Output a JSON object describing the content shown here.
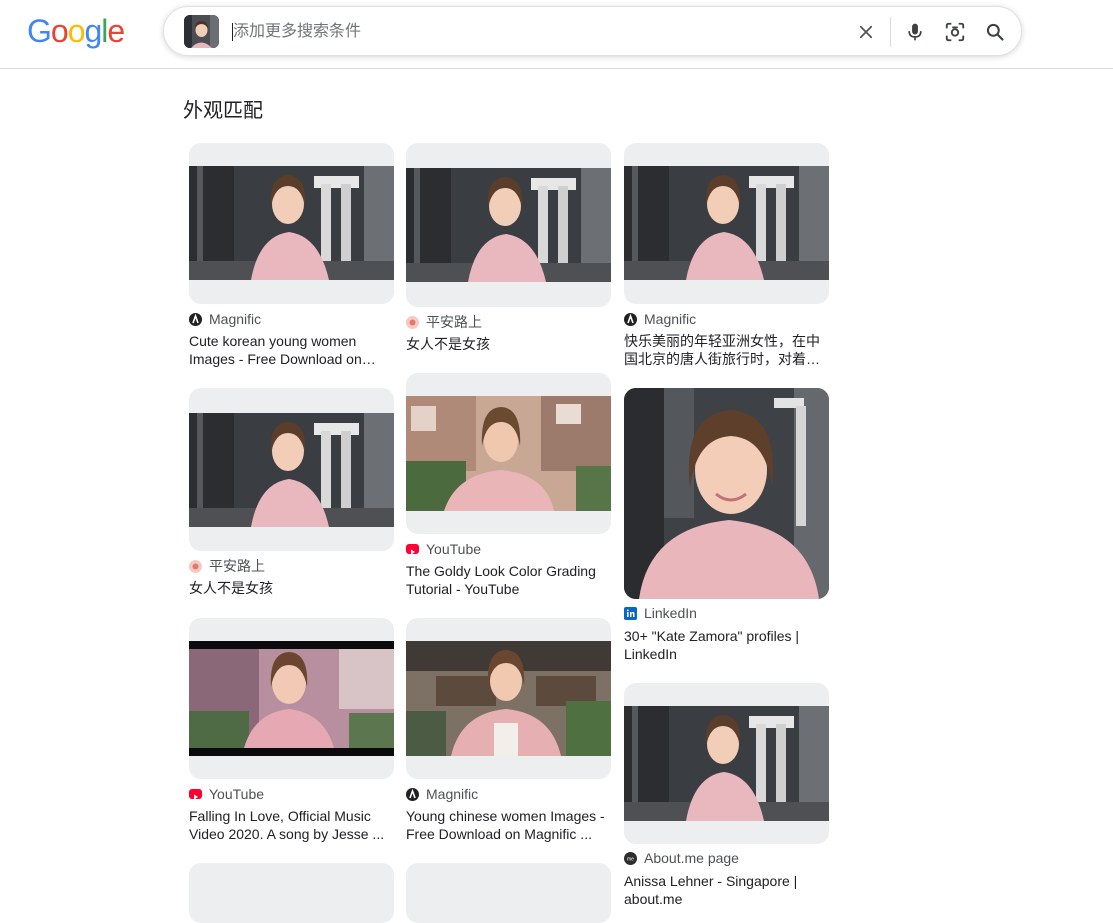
{
  "search": {
    "placeholder": "添加更多搜索条件",
    "value": ""
  },
  "logo": {
    "letters": [
      "G",
      "o",
      "o",
      "g",
      "l",
      "e"
    ],
    "colors": [
      "#4285F4",
      "#EA4335",
      "#FBBC05",
      "#4285F4",
      "#34A853",
      "#EA4335"
    ]
  },
  "section": {
    "title": "外观匹配"
  },
  "results": [
    {
      "source": "Magnific",
      "favicon": "magnific-icon",
      "title": "Cute korean young women Images - Free Download on…"
    },
    {
      "source": "平安路上",
      "favicon": "pinganlushang-icon",
      "title": "女人不是女孩"
    },
    {
      "source": "Magnific",
      "favicon": "magnific-icon",
      "title": "快乐美丽的年轻亚洲女性，在中国北京的唐人街旅行时，对着…"
    },
    {
      "source": "平安路上",
      "favicon": "pinganlushang-icon",
      "title": "女人不是女孩"
    },
    {
      "source": "YouTube",
      "favicon": "youtube-icon",
      "title": "The Goldy Look Color Grading Tutorial - YouTube"
    },
    {
      "source": "LinkedIn",
      "favicon": "linkedin-icon",
      "title": "30+ \"Kate Zamora\" profiles | LinkedIn"
    },
    {
      "source": "YouTube",
      "favicon": "youtube-icon",
      "title": "Falling In Love, Official Music Video 2020. A song by Jesse ..."
    },
    {
      "source": "Magnific",
      "favicon": "magnific-icon",
      "title": "Young chinese women Images - Free Download on Magnific ..."
    },
    {
      "source": "About.me page",
      "favicon": "aboutme-icon",
      "title": "Anissa Lehner - Singapore | about.me"
    }
  ],
  "colors": {
    "youtube": "#FF0033",
    "linkedin": "#0A66C2",
    "magnific": "#202124"
  }
}
